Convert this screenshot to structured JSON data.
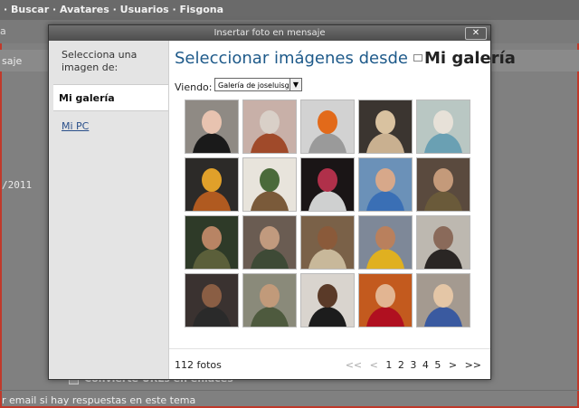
{
  "background": {
    "nav": "· Buscar · Avatares · Usuarios · Fisgona",
    "left_bar2": "a",
    "left_bar3": "saje",
    "date_fragment": "/2011",
    "convert_urls": "Convierte URLs en enlaces",
    "email_notice": "r email si hay respuestas en este tema"
  },
  "dialog": {
    "title": "Insertar foto en mensaje",
    "close_label": "✕",
    "sidebar": {
      "heading": "Selecciona una imagen de:",
      "items": [
        {
          "label": "Mi galería"
        },
        {
          "label": "Mi PC"
        }
      ]
    },
    "main": {
      "heading_prefix": "Seleccionar imágenes desde",
      "heading_gallery": "Mi galería",
      "viendo_label": "Viendo:",
      "viendo_value": "Galería de joseluisgh9",
      "photos": [
        {
          "bg": "#8f8a84",
          "fg": "#e8c3b0",
          "alt": "#1a1a1a"
        },
        {
          "bg": "#c8b0a8",
          "fg": "#d9d0c8",
          "alt": "#a04a2a"
        },
        {
          "bg": "#d2d2d2",
          "fg": "#e26a1a",
          "alt": "#9a9a9a"
        },
        {
          "bg": "#3b3530",
          "fg": "#d9c2a0",
          "alt": "#c9b090"
        },
        {
          "bg": "#b9c7c3",
          "fg": "#e7e1d8",
          "alt": "#6aa0b3"
        },
        {
          "bg": "#2c2a28",
          "fg": "#e0a02a",
          "alt": "#b05a20"
        },
        {
          "bg": "#e8e4dc",
          "fg": "#4a6a3a",
          "alt": "#7a5a3a"
        },
        {
          "bg": "#1a1516",
          "fg": "#b0304a",
          "alt": "#cfd0d0"
        },
        {
          "bg": "#6b91b8",
          "fg": "#d7a88a",
          "alt": "#3a6fb5"
        },
        {
          "bg": "#5a4a3e",
          "fg": "#c49a7a",
          "alt": "#6a5a3a"
        },
        {
          "bg": "#2e3a28",
          "fg": "#b88464",
          "alt": "#5b5f3a"
        },
        {
          "bg": "#6a5c52",
          "fg": "#c19a7e",
          "alt": "#3e4a36"
        },
        {
          "bg": "#7a6148",
          "fg": "#8a5a3a",
          "alt": "#c8b89a"
        },
        {
          "bg": "#7e8898",
          "fg": "#b9805d",
          "alt": "#e0b020"
        },
        {
          "bg": "#bdb8b0",
          "fg": "#8a6a5a",
          "alt": "#2a2624"
        },
        {
          "bg": "#3a3230",
          "fg": "#8a5e44",
          "alt": "#2a2a2a"
        },
        {
          "bg": "#8a8a7a",
          "fg": "#c19a7a",
          "alt": "#4e5a3e"
        },
        {
          "bg": "#d9d4ce",
          "fg": "#5a3a28",
          "alt": "#1c1c1c"
        },
        {
          "bg": "#c35a1e",
          "fg": "#e2b592",
          "alt": "#b01020"
        },
        {
          "bg": "#a49a90",
          "fg": "#e4c6a6",
          "alt": "#3a5aa0"
        }
      ],
      "count": "112 fotos",
      "pager": {
        "first": "<<",
        "prev": "<",
        "pages": [
          "1",
          "2",
          "3",
          "4",
          "5"
        ],
        "next": ">",
        "last": ">>"
      }
    }
  }
}
